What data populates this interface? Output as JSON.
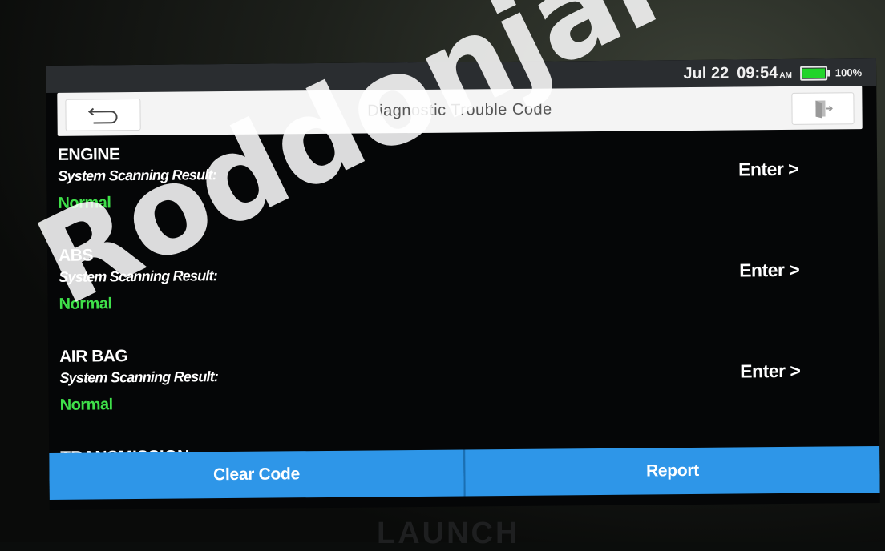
{
  "status_bar": {
    "date": "Jul 22",
    "time": "09:54",
    "ampm": "AM",
    "battery_percent": "100%",
    "battery_level": 1.0,
    "battery_color": "#22d42a"
  },
  "header": {
    "title": "Diagnostic Trouble Code",
    "back_icon": "back-arrow-icon",
    "exit_icon": "exit-door-icon"
  },
  "systems": [
    {
      "name": "ENGINE",
      "scan_label": "System Scanning Result:",
      "status": "Normal",
      "action": "Enter >"
    },
    {
      "name": "ABS",
      "scan_label": "System Scanning Result:",
      "status": "Normal",
      "action": "Enter >"
    },
    {
      "name": "AIR BAG",
      "scan_label": "System Scanning Result:",
      "status": "Normal",
      "action": "Enter >"
    }
  ],
  "partial_item": "TRANSMISSION",
  "footer": {
    "clear_code_label": "Clear Code",
    "report_label": "Report"
  },
  "device_brand": "LAUNCH",
  "watermark_text": "Roddonjai :D",
  "colors": {
    "status_normal": "#3fe04a",
    "button_blue": "#2e96e8"
  }
}
